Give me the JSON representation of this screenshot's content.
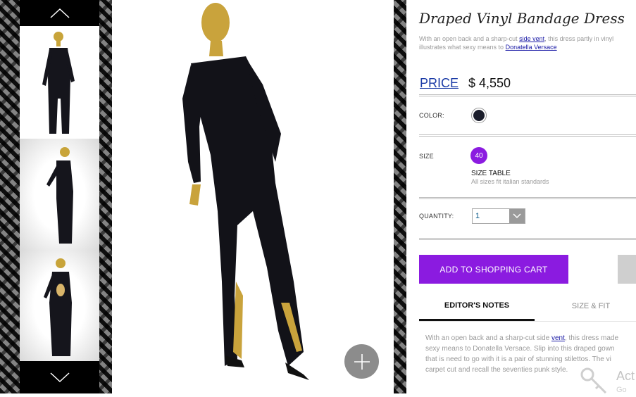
{
  "product": {
    "title": "Draped Vinyl Bandage Dress",
    "description_prefix": "With an open back and a sharp-cut",
    "description_link1": "side vent",
    "description_middle": ", this dress partly in vinyl illustrates what sexy means to",
    "description_link2": "Donatella Versace",
    "price_label": "PRICE",
    "price_value": "$ 4,550"
  },
  "options": {
    "color_label": "COLOR:",
    "color_swatch": "#1a1d2b",
    "size_label": "SIZE",
    "size_value": "40",
    "size_table": "SIZE TABLE",
    "size_note": "All sizes fit italian standards",
    "quantity_label": "QUANTITY:",
    "quantity_value": "1"
  },
  "actions": {
    "add_to_cart": "ADD TO SHOPPING CART"
  },
  "tabs": [
    {
      "label": "EDITOR'S NOTES",
      "active": true
    },
    {
      "label": "SIZE & FIT",
      "active": false
    }
  ],
  "editors_notes": {
    "line1_prefix": "With an open back and a sharp-cut side ",
    "line1_link": "vent",
    "line1_suffix": ", this dress made",
    "line2": "sexy means to Donatella Versace. Slip into this draped gown",
    "line3": "that is need to go with it is a pair of stunning stilettos. The vi",
    "line4": "carpet cut and recall the seventies punk style."
  },
  "watermark": {
    "text": "Act",
    "subtext": "Go"
  },
  "colors": {
    "accent": "#8b1be0",
    "link": "#1a3aa6",
    "zoom_button": "#8c8c8c"
  }
}
